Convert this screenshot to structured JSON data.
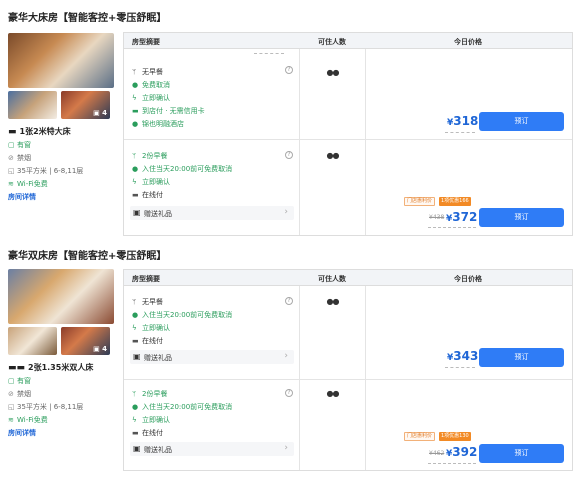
{
  "rooms": [
    {
      "title": "豪华大床房【智能客控+零压舒眠】",
      "photo_count": "4",
      "bed": "1张2米特大床",
      "features": [
        "有窗",
        "禁烟",
        "35平方米 | 6-8,11层",
        "Wi-Fi免费"
      ],
      "details_link": "房间详情",
      "headers": {
        "policy": "房型摘要",
        "occupancy": "可住人数",
        "price": "今日价格"
      },
      "rates": [
        {
          "lines": [
            "无早餐",
            "免费取消",
            "立即确认",
            "到店付 · 无需信用卡",
            "锦也明融酒店"
          ],
          "occupancy": "2人",
          "price": "318",
          "currency": "¥",
          "book": "预订"
        },
        {
          "lines": [
            "2份早餐",
            "入住当天20:00前可免费取消",
            "立即确认",
            "在线付"
          ],
          "gift": "赠送礼品",
          "occupancy": "2人",
          "tag1": "门店惠利价",
          "tag2": "1项优惠166",
          "original": "¥438",
          "price": "372",
          "currency": "¥",
          "book": "预订"
        }
      ]
    },
    {
      "title": "豪华双床房【智能客控+零压舒眠】",
      "photo_count": "4",
      "bed": "2张1.35米双人床",
      "features": [
        "有窗",
        "禁烟",
        "35平方米 | 6-8,11层",
        "Wi-Fi免费"
      ],
      "details_link": "房间详情",
      "headers": {
        "policy": "房型摘要",
        "occupancy": "可住人数",
        "price": "今日价格"
      },
      "rates": [
        {
          "lines": [
            "无早餐",
            "入住当天20:00前可免费取消",
            "立即确认",
            "在线付"
          ],
          "gift": "赠送礼品",
          "occupancy": "2人",
          "price": "343",
          "currency": "¥",
          "book": "预订"
        },
        {
          "lines": [
            "2份早餐",
            "入住当天20:00前可免费取消",
            "立即确认",
            "在线付"
          ],
          "gift": "赠送礼品",
          "occupancy": "2人",
          "tag1": "门店惠利价",
          "tag2": "1项优惠130",
          "original": "¥462",
          "price": "392",
          "currency": "¥",
          "book": "预订"
        }
      ]
    }
  ],
  "icons": {
    "meal": "utensils-icon",
    "check": "check-circle-icon",
    "bolt": "lightning-icon",
    "card": "credit-card-icon",
    "gift": "gift-icon",
    "people": "two-people-icon",
    "bed": "bed-icon"
  },
  "colors": {
    "accent": "#2f7cf6",
    "green": "#2a9d5c",
    "price": "#1f66d6",
    "orange": "#f28a25"
  }
}
